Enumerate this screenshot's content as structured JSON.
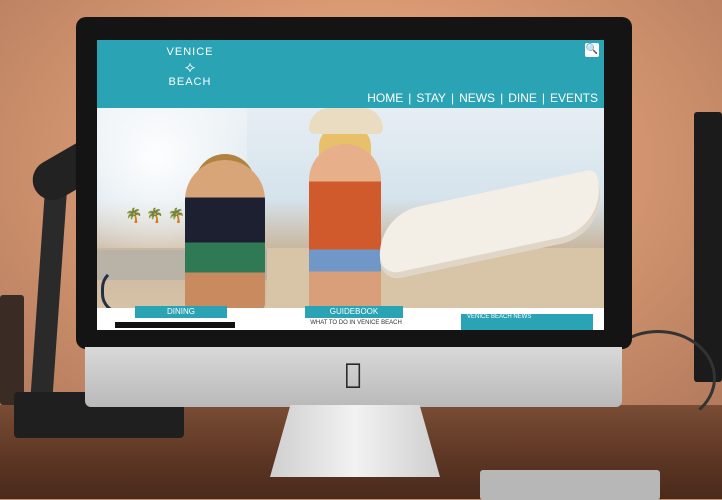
{
  "site": {
    "logo": {
      "top": "VENICE",
      "bottom": "BEACH",
      "mark": "⟡"
    },
    "nav": [
      "HOME",
      "STAY",
      "NEWS",
      "DINE",
      "EVENTS"
    ],
    "search_icon": "search-icon"
  },
  "tiles": {
    "dining": "DINING",
    "guidebook": "GUIDEBOOK",
    "guidebook_sub": "WHAT TO DO IN VENICE BEACH",
    "side_text": "VENICE BEACH NEWS"
  },
  "device": {
    "logo_icon": "apple-logo-icon"
  },
  "colors": {
    "brand_teal": "#2aa3b5"
  }
}
